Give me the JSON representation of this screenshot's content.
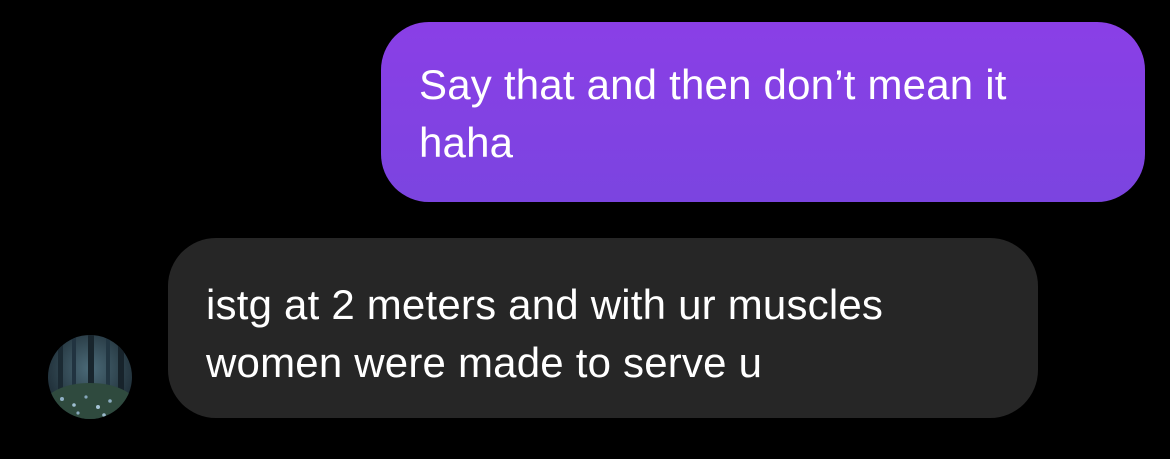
{
  "thread": {
    "messages": [
      {
        "direction": "sent",
        "text": "Say that and then don’t mean it\nhaha"
      },
      {
        "direction": "received",
        "text": "istg at 2 meters and with ur muscles\nwomen were made to serve u",
        "sender_avatar_icon": "forest-avatar-icon"
      }
    ]
  },
  "colors": {
    "background": "#000000",
    "sent_bubble": "#8440e3",
    "received_bubble": "#262626",
    "text": "#ffffff"
  }
}
